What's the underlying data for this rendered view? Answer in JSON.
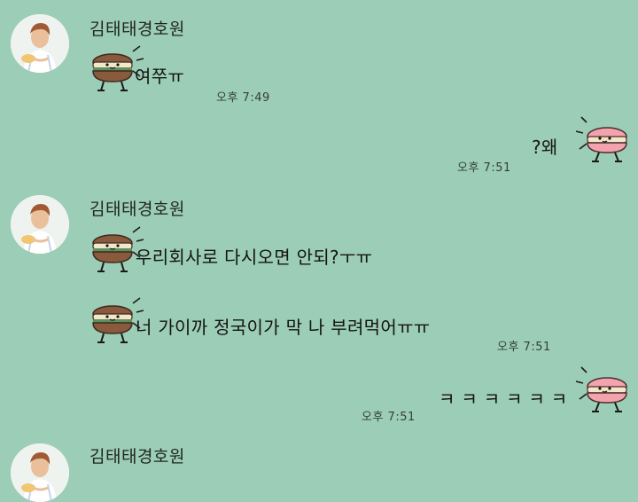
{
  "chat": {
    "messages": [
      {
        "sender": "김태태경호원",
        "text": "여쭈ㅠ",
        "time": "오후 7:49"
      },
      {
        "text": "?왜",
        "time": "오후 7:51"
      },
      {
        "sender": "김태태경호원",
        "text1": "우리회사로 다시오면 안되?ㅜㅠ",
        "text2": "너 가이까 정국이가 막 나 부려먹어ㅠㅠ",
        "time": "오후 7:51"
      },
      {
        "text": "ㅋ ㅋ ㅋ ㅋ ㅋ ㅋ",
        "time": "오후 7:51"
      },
      {
        "sender": "김태태경호원"
      }
    ]
  },
  "icons": {
    "avatar": "profile-photo",
    "incoming_sticker": "brown-macaron-character",
    "outgoing_sticker": "pink-macaron-character"
  },
  "colors": {
    "background": "#9ccdb6",
    "brown_macaron": "#8a5a3c",
    "pink_macaron": "#f3a3ad",
    "cream": "#f4e6c8"
  }
}
